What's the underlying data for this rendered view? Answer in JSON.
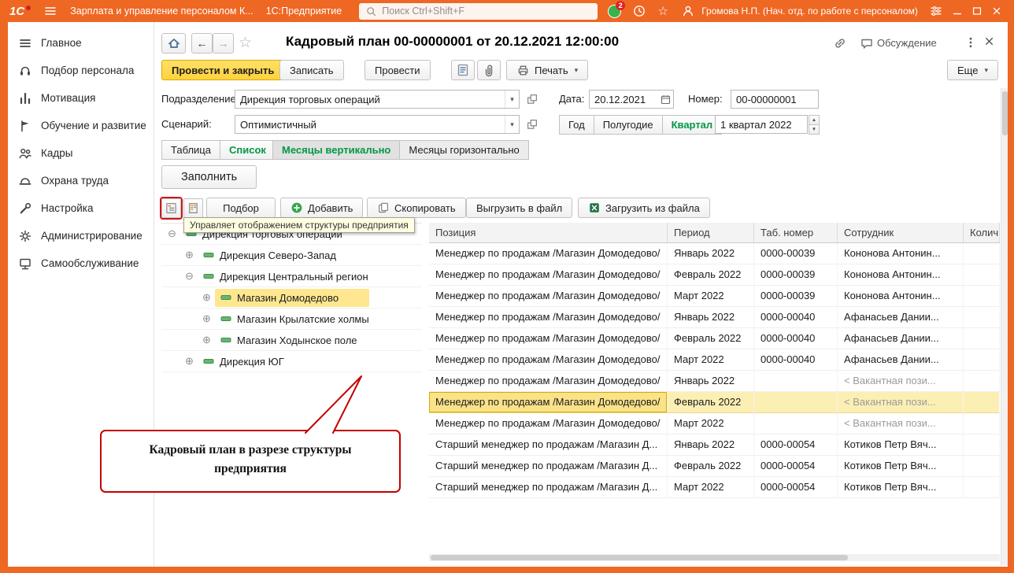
{
  "titlebar": {
    "logo": "1С",
    "app_title": "Зарплата и управление персоналом К...",
    "app_kind": "1С:Предприятие",
    "search_placeholder": "Поиск Ctrl+Shift+F",
    "notification_badge": "2",
    "user_name": "Громова Н.П. (Нач. отд. по работе с персоналом)"
  },
  "sidebar": {
    "items": [
      {
        "id": "glavnoe",
        "label": "Главное",
        "icon": "menu-icon"
      },
      {
        "id": "podbor-personala",
        "label": "Подбор персонала",
        "icon": "headset-icon"
      },
      {
        "id": "motivaciya",
        "label": "Мотивация",
        "icon": "chart-icon"
      },
      {
        "id": "obuchenie",
        "label": "Обучение и развитие",
        "icon": "flag-icon"
      },
      {
        "id": "kadry",
        "label": "Кадры",
        "icon": "people-icon"
      },
      {
        "id": "ohrana-truda",
        "label": "Охрана труда",
        "icon": "helmet-icon"
      },
      {
        "id": "nastroyka",
        "label": "Настройка",
        "icon": "wrench-icon"
      },
      {
        "id": "administrirovanie",
        "label": "Администрирование",
        "icon": "gear-icon"
      },
      {
        "id": "samoobsluzhivanie",
        "label": "Самообслуживание",
        "icon": "kiosk-icon"
      }
    ]
  },
  "header": {
    "title": "Кадровый план 00-00000001 от 20.12.2021 12:00:00",
    "discussion_label": "Обсуждение"
  },
  "toolbar": {
    "post_and_close": "Провести и закрыть",
    "save": "Записать",
    "post": "Провести",
    "print": "Печать",
    "more": "Еще"
  },
  "form": {
    "department_label": "Подразделение:",
    "department_value": "Дирекция торговых операций",
    "date_label": "Дата:",
    "date_value": "20.12.2021",
    "number_label": "Номер:",
    "number_value": "00-00000001",
    "scenario_label": "Сценарий:",
    "scenario_value": "Оптимистичный",
    "period_buttons": [
      "Год",
      "Полугодие",
      "Квартал"
    ],
    "period_selected": "Квартал",
    "period_value": "1 квартал 2022",
    "view_buttons": [
      "Таблица",
      "Список"
    ],
    "view_selected": "Список",
    "month_mode_buttons": [
      "Месяцы вертикально",
      "Месяцы горизонтально"
    ],
    "month_mode_selected": "Месяцы вертикально",
    "fill_button": "Заполнить"
  },
  "grid_toolbar": {
    "pick": "Подбор",
    "add": "Добавить",
    "copy": "Скопировать",
    "export_file": "Выгрузить в файл",
    "import_file": "Загрузить из файла",
    "tooltip": "Управляет отображением структуры предприятия"
  },
  "tree": {
    "items": [
      {
        "label": "Дирекция торговых операций",
        "level": 0,
        "expander": "minus",
        "selected": false
      },
      {
        "label": "Дирекция Северо-Запад",
        "level": 1,
        "expander": "plus",
        "selected": false
      },
      {
        "label": "Дирекция Центральный регион",
        "level": 1,
        "expander": "minus",
        "selected": false
      },
      {
        "label": "Магазин Домодедово",
        "level": 2,
        "expander": "plus",
        "selected": true
      },
      {
        "label": "Магазин Крылатские холмы",
        "level": 2,
        "expander": "plus",
        "selected": false
      },
      {
        "label": "Магазин Ходынское поле",
        "level": 2,
        "expander": "plus",
        "selected": false
      },
      {
        "label": "Дирекция ЮГ",
        "level": 1,
        "expander": "plus",
        "selected": false
      }
    ]
  },
  "callout": {
    "text": "Кадровый план в разрезе структуры предприятия"
  },
  "table": {
    "columns": [
      "Позиция",
      "Период",
      "Таб. номер",
      "Сотрудник",
      "Колич. ст..."
    ],
    "selected_row": 7,
    "rows": [
      {
        "position": "Менеджер по продажам /Магазин Домодедово/",
        "period": "Январь 2022",
        "tab_no": "0000-00039",
        "employee": "Кононова Антонин...",
        "vacant": false
      },
      {
        "position": "Менеджер по продажам /Магазин Домодедово/",
        "period": "Февраль 2022",
        "tab_no": "0000-00039",
        "employee": "Кононова Антонин...",
        "vacant": false
      },
      {
        "position": "Менеджер по продажам /Магазин Домодедово/",
        "period": "Март 2022",
        "tab_no": "0000-00039",
        "employee": "Кононова Антонин...",
        "vacant": false
      },
      {
        "position": "Менеджер по продажам /Магазин Домодедово/",
        "period": "Январь 2022",
        "tab_no": "0000-00040",
        "employee": "Афанасьев Дании...",
        "vacant": false
      },
      {
        "position": "Менеджер по продажам /Магазин Домодедово/",
        "period": "Февраль 2022",
        "tab_no": "0000-00040",
        "employee": "Афанасьев Дании...",
        "vacant": false
      },
      {
        "position": "Менеджер по продажам /Магазин Домодедово/",
        "period": "Март 2022",
        "tab_no": "0000-00040",
        "employee": "Афанасьев Дании...",
        "vacant": false
      },
      {
        "position": "Менеджер по продажам /Магазин Домодедово/",
        "period": "Январь 2022",
        "tab_no": "",
        "employee": "< Вакантная пози...",
        "vacant": true
      },
      {
        "position": "Менеджер по продажам /Магазин Домодедово/",
        "period": "Февраль 2022",
        "tab_no": "",
        "employee": "< Вакантная пози...",
        "vacant": true
      },
      {
        "position": "Менеджер по продажам /Магазин Домодедово/",
        "period": "Март 2022",
        "tab_no": "",
        "employee": "< Вакантная пози...",
        "vacant": true
      },
      {
        "position": "Старший менеджер по продажам /Магазин Д...",
        "period": "Январь 2022",
        "tab_no": "0000-00054",
        "employee": "Котиков Петр Вяч...",
        "vacant": false
      },
      {
        "position": "Старший менеджер по продажам /Магазин Д...",
        "period": "Февраль 2022",
        "tab_no": "0000-00054",
        "employee": "Котиков Петр Вяч...",
        "vacant": false
      },
      {
        "position": "Старший менеджер по продажам /Магазин Д...",
        "period": "Март 2022",
        "tab_no": "0000-00054",
        "employee": "Котиков Петр Вяч...",
        "vacant": false
      }
    ]
  },
  "colors": {
    "accent_orange": "#ee6723",
    "action_green": "#009845",
    "selection_yellow": "#ffe78f",
    "primary_button_yellow": "#ffd23e",
    "annotation_red": "#c40000"
  }
}
